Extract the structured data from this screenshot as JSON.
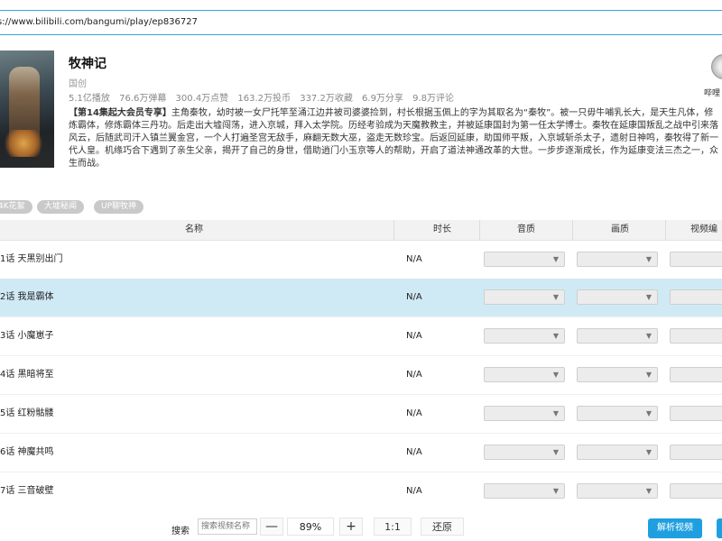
{
  "url": "s://www.bilibili.com/bangumi/play/ep836727",
  "show": {
    "title": "牧神记",
    "type": "国创",
    "stats": [
      "5.1亿播放",
      "76.6万弹幕",
      "300.4万点赞",
      "163.2万投币",
      "337.2万收藏",
      "6.9万分享",
      "9.8万评论"
    ],
    "desc_emph": "【第14集起大会员专享】",
    "desc": "主角秦牧，幼时被一女尸托竿至涌江边井被司婆婆捡到，村长根据玉佩上的字为其取名为“秦牧”。被一只毋牛哺乳长大，是天生凡体，修炼霸体，修炼霸体三丹功。后走出大墟闯荡，进入京城，拜入太学院。历经考验成为天魔教教主，并被延康国封为第一任太学博士。秦牧在延康国叛乱之战中引来落风云，后随武司汗入镇兰翼金宫，一个人打遍圣宫无敌手，麻翻无数大巫，盗走无数珍宝。后返回延康，助国师平叛，入京城斩杀太子，遗射日神鸣，秦牧得了新一代人皇。机缘巧合下遇到了亲生父亲，揭开了自己的身世，借助逍门小玉京等人的帮助，开启了道法神通改革的大世。一步步逐渐成长，作为延康变法三杰之一，众生而战。"
  },
  "uploader": {
    "name": "哔哩"
  },
  "tags": [
    "4K花絮",
    "大墟秘闻",
    "UP聊牧神"
  ],
  "table": {
    "headers": {
      "name": "名称",
      "duration": "时长",
      "audio": "音质",
      "video": "画质",
      "codec": "视频编"
    },
    "rows": [
      {
        "name": "1话 天黑别出门",
        "duration": "N/A",
        "selected": false
      },
      {
        "name": "2话 我是霸体",
        "duration": "N/A",
        "selected": true
      },
      {
        "name": "3话 小魔崽子",
        "duration": "N/A",
        "selected": false
      },
      {
        "name": "4话 黑暗将至",
        "duration": "N/A",
        "selected": false
      },
      {
        "name": "5话 红粉骷髅",
        "duration": "N/A",
        "selected": false
      },
      {
        "name": "6话 神魔共鸣",
        "duration": "N/A",
        "selected": false
      },
      {
        "name": "7话 三音破壁",
        "duration": "N/A",
        "selected": false
      }
    ]
  },
  "bottom": {
    "search_label": "搜索",
    "search_placeholder": "搜索视频名称",
    "zoom_minus": "—",
    "zoom_value": "89%",
    "zoom_plus": "+",
    "ratio": "1:1",
    "restore": "还原",
    "parse": "解析视频"
  },
  "colors": {
    "accent": "#1f9fe0",
    "selected_row": "#cfeaf5",
    "tag_bg": "#c9c9c9"
  }
}
